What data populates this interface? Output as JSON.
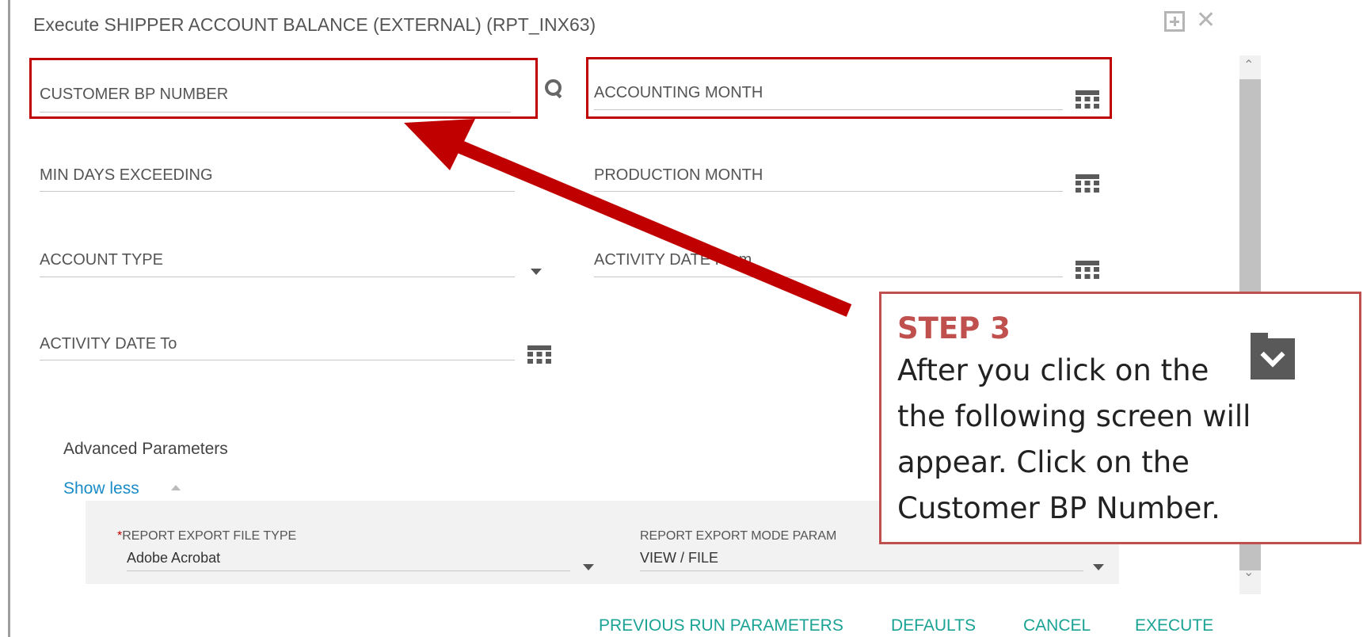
{
  "window": {
    "title": "Execute SHIPPER ACCOUNT BALANCE (EXTERNAL) (RPT_INX63)",
    "maximize_icon": "maximize-icon",
    "close_glyph": "✕"
  },
  "fields": {
    "customer_bp_number": "CUSTOMER BP NUMBER",
    "accounting_month": "ACCOUNTING MONTH",
    "min_days_exceeding": "MIN DAYS EXCEEDING",
    "production_month": "PRODUCTION MONTH",
    "account_type": "ACCOUNT TYPE",
    "activity_date_from": "ACTIVITY DATE From",
    "activity_date_to": "ACTIVITY DATE To"
  },
  "advanced": {
    "heading": "Advanced Parameters",
    "toggle": "Show less",
    "export_file_type_label": "REPORT EXPORT FILE TYPE",
    "export_file_type_value": "Adobe Acrobat",
    "export_mode_label": "REPORT EXPORT MODE PARAM",
    "export_mode_value": "VIEW / FILE",
    "required_marker": "*"
  },
  "actions": {
    "previous_run": "PREVIOUS RUN PARAMETERS",
    "defaults": "DEFAULTS",
    "cancel": "CANCEL",
    "execute": "EXECUTE"
  },
  "scrollbar": {
    "up": "⌃",
    "down": "⌄"
  },
  "callout": {
    "step": "STEP 3",
    "line1": "After you click on the",
    "line2": "the following screen will",
    "line3": "appear. Click on the",
    "line4": "Customer BP Number."
  },
  "colors": {
    "highlight": "#c00000",
    "callout_border": "#c0504d",
    "link": "#1a8bc7",
    "action": "#1aa394"
  }
}
